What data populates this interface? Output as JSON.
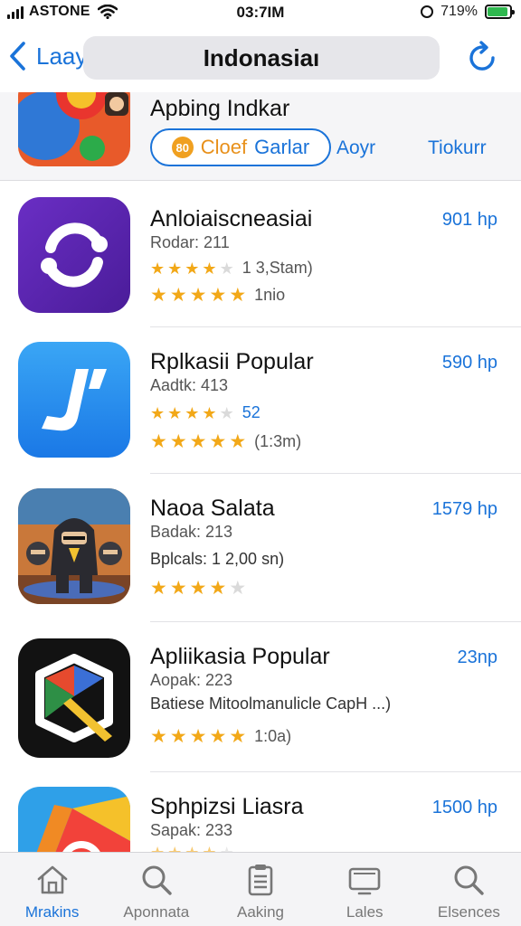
{
  "status_bar": {
    "carrier": "ASTONE",
    "time": "03:7IM",
    "battery_text": "719%",
    "battery_level": 0.9
  },
  "nav": {
    "back_label": "Laay",
    "title": "Indonasiaı"
  },
  "featured": {
    "name": "Apbing Indkar",
    "button_badge": "80",
    "button_label_a": "Cloef",
    "button_label_b": "Garlar",
    "link_1": "Aoyr",
    "link_2": "Tiokurr"
  },
  "apps": [
    {
      "name": "Anloiaiscneasiai",
      "line_1": "Rodar: 211",
      "rating_1": {
        "stars": 3.5,
        "text": "1 3,Stam)"
      },
      "rating_2": {
        "stars": 4.5,
        "text": "1nio"
      },
      "price": "901 hp",
      "icon": "purple-circular-arrows-icon"
    },
    {
      "name": "Rplkasii Popular",
      "line_1": "Aadtk: 413",
      "rating_1": {
        "stars": 4,
        "text": "52"
      },
      "rating_2": {
        "stars": 4.5,
        "text": "(1:3m)"
      },
      "price": "590 hp",
      "icon": "blue-j-logo-icon"
    },
    {
      "name": "Naoa Salata",
      "line_1": "Badak: 213",
      "line_2": "Bplcals: 1 2,00 sn)",
      "rating_1": {
        "stars": 4,
        "text": ""
      },
      "price": "1579 hp",
      "icon": "ninja-game-icon"
    },
    {
      "name": "Apliikasia Popular",
      "line_1": "Aopak: 223",
      "line_2": "Batiese Mitoolmanulicle CapH  ...)",
      "rating_1": {
        "stars": 4.5,
        "text": "1:0a)"
      },
      "price": "23np",
      "icon": "geometric-m-logo-icon"
    },
    {
      "name": "Sphpizsi Liasra",
      "line_1": "Sapak: 233",
      "rating_1": {
        "stars": 4,
        "text": ""
      },
      "price": "1500 hp",
      "icon": "colorful-app-icon"
    }
  ],
  "tabs": [
    {
      "label": "Mrakins",
      "icon": "home-icon",
      "active": true
    },
    {
      "label": "Aponnata",
      "icon": "search-icon",
      "active": false
    },
    {
      "label": "Aaking",
      "icon": "clipboard-icon",
      "active": false
    },
    {
      "label": "Lales",
      "icon": "display-icon",
      "active": false
    },
    {
      "label": "Elsences",
      "icon": "search-icon",
      "active": false
    }
  ],
  "colors": {
    "accent": "#1a73d9",
    "star": "#f2a818",
    "star_off": "#dadada",
    "battery": "#2fb84f"
  }
}
